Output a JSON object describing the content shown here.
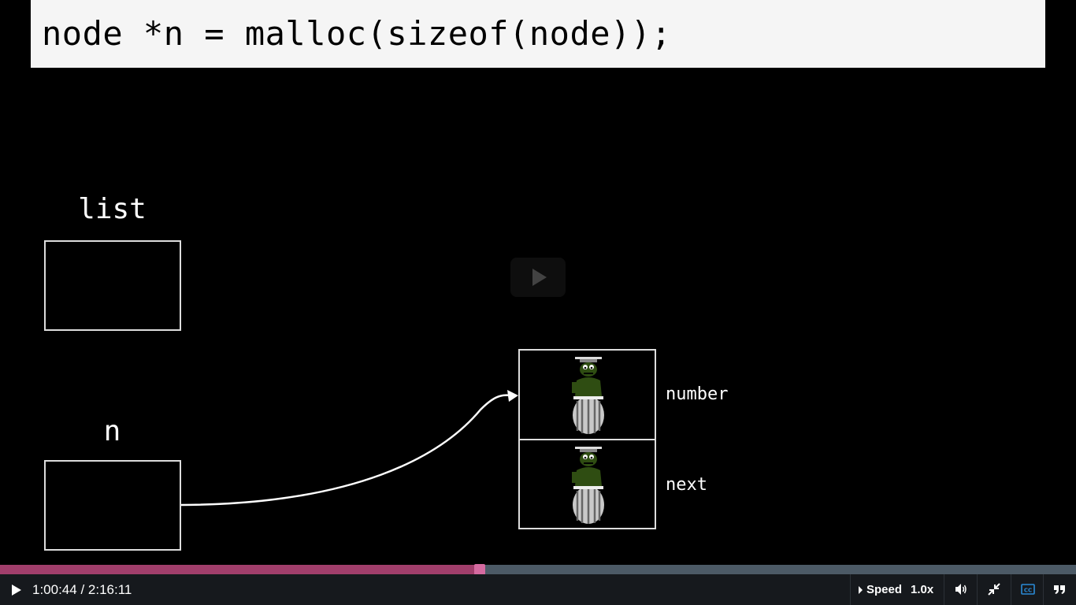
{
  "slide": {
    "code_line": "node *n = malloc(sizeof(node));",
    "list_label": "list",
    "n_label": "n",
    "node_fields": {
      "number_label": "number",
      "next_label": "next"
    }
  },
  "player": {
    "current_time": "1:00:44",
    "total_time": "2:16:11",
    "time_separator": " / ",
    "progress": 0.446,
    "speed_label": "Speed",
    "speed_value": "1.0x",
    "colors": {
      "progress_played": "#a13e6b",
      "progress_track": "#4c5a66",
      "controls_bg": "#16191d",
      "cc_active": "#2a8ad6"
    },
    "icons": [
      "play-icon",
      "volume-icon",
      "exit-fullscreen-icon",
      "closed-captions-icon",
      "transcript-icon"
    ]
  }
}
